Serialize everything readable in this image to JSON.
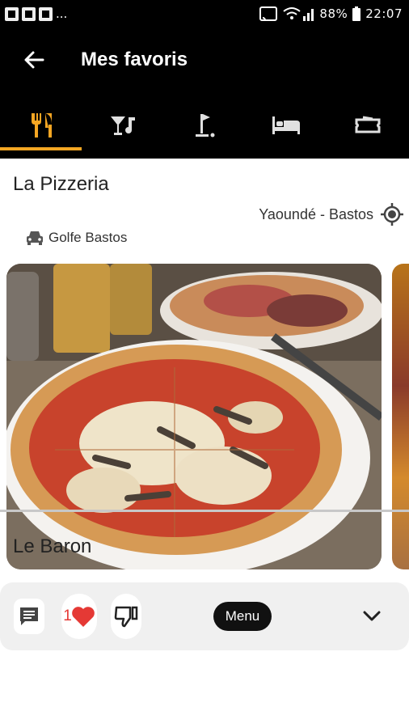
{
  "status_bar": {
    "dots": "...",
    "battery": "88%",
    "time": "22:07"
  },
  "app_bar": {
    "title": "Mes favoris",
    "back_icon": "arrow-left-icon"
  },
  "tabs": [
    {
      "icon": "restaurant-icon",
      "active": true
    },
    {
      "icon": "bar-music-icon",
      "active": false
    },
    {
      "icon": "golf-icon",
      "active": false
    },
    {
      "icon": "hotel-bed-icon",
      "active": false
    },
    {
      "icon": "ticket-icon",
      "active": false
    }
  ],
  "colors": {
    "accent": "#f5a623",
    "like": "#e53935",
    "bar_background": "#000000"
  },
  "favorites": [
    {
      "name": "La Pizzeria",
      "location": "Yaoundé - Bastos",
      "nearby": "Golfe Bastos",
      "likes": "1",
      "menu_label": "Menu"
    },
    {
      "name": "Le Baron"
    }
  ]
}
